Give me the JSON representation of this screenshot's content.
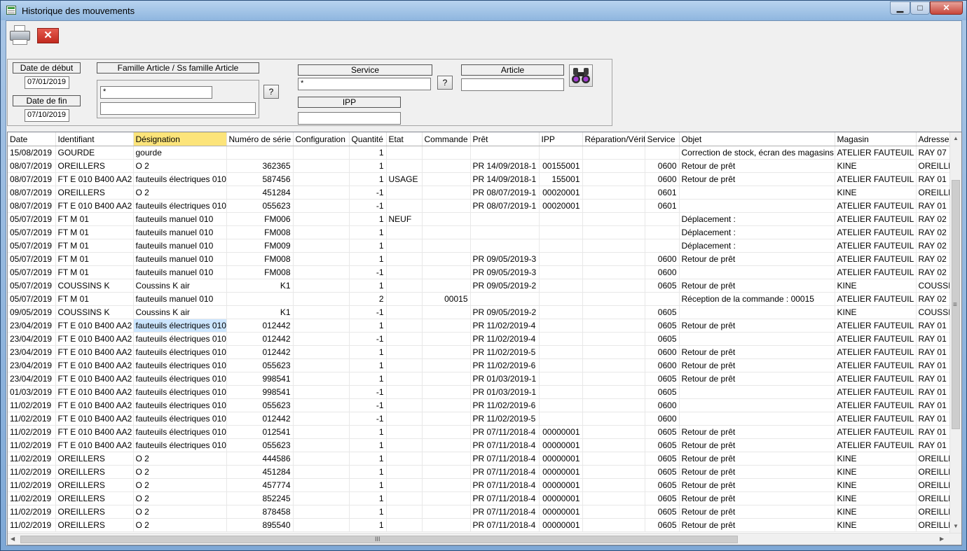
{
  "window": {
    "title": "Historique des mouvements",
    "min_glyph": "▁",
    "max_glyph": "□",
    "close_glyph": "✕"
  },
  "toolbar": {
    "print_icon": "printer-icon",
    "close_glyph": "✕"
  },
  "filters": {
    "date_debut_label": "Date de début",
    "date_debut_value": "07/01/2019",
    "date_fin_label": "Date de fin",
    "date_fin_value": "07/10/2019",
    "famille_label": "Famille Article / Ss famille Article",
    "famille_value": "*",
    "sous_famille_value": "",
    "service_label": "Service",
    "service_value": "*",
    "ipp_label": "IPP",
    "ipp_value": "",
    "article_label": "Article",
    "article_value": "",
    "help_label": "?",
    "search_icon": "binoculars-icon"
  },
  "grid": {
    "columns": [
      "Date",
      "Identifiant",
      "Désignation",
      "Numéro de série",
      "Configuration",
      "Quantité",
      "Etat",
      "Commande",
      "Prêt",
      "IPP",
      "Réparation/Vérifi",
      "Service",
      "Objet",
      "Magasin",
      "Adresse"
    ],
    "rows": [
      [
        "15/08/2019",
        "GOURDE",
        "gourde",
        "",
        "",
        "1",
        "",
        "",
        "",
        "",
        "",
        "",
        "Correction de stock, écran des magasins :",
        "ATELIER FAUTEUIL",
        "RAY 07"
      ],
      [
        "08/07/2019",
        "OREILLERS",
        "O 2",
        "362365",
        "",
        "1",
        "",
        "",
        "PR 14/09/2018-1",
        "00155001",
        "",
        "0600",
        "Retour de prêt",
        "KINE",
        "OREILLE"
      ],
      [
        "08/07/2019",
        "FT E 010 B400 AA2",
        "fauteuils électriques 010",
        "587456",
        "",
        "1",
        "USAGE",
        "",
        "PR 14/09/2018-1",
        "155001",
        "",
        "0600",
        "Retour de prêt",
        "ATELIER FAUTEUIL",
        "RAY 01"
      ],
      [
        "08/07/2019",
        "OREILLERS",
        "O 2",
        "451284",
        "",
        "-1",
        "",
        "",
        "PR 08/07/2019-1",
        "00020001",
        "",
        "0601",
        "",
        "KINE",
        "OREILLE"
      ],
      [
        "08/07/2019",
        "FT E 010 B400 AA2",
        "fauteuils électriques 010",
        "055623",
        "",
        "-1",
        "",
        "",
        "PR 08/07/2019-1",
        "00020001",
        "",
        "0601",
        "",
        "ATELIER FAUTEUIL",
        "RAY 01"
      ],
      [
        "05/07/2019",
        "FT M 01",
        "fauteuils manuel 010",
        "FM006",
        "",
        "1",
        "NEUF",
        "",
        "",
        "",
        "",
        "",
        "Déplacement :",
        "ATELIER FAUTEUIL",
        "RAY 02"
      ],
      [
        "05/07/2019",
        "FT M 01",
        "fauteuils manuel 010",
        "FM008",
        "",
        "1",
        "",
        "",
        "",
        "",
        "",
        "",
        "Déplacement :",
        "ATELIER FAUTEUIL",
        "RAY 02"
      ],
      [
        "05/07/2019",
        "FT M 01",
        "fauteuils manuel 010",
        "FM009",
        "",
        "1",
        "",
        "",
        "",
        "",
        "",
        "",
        "Déplacement :",
        "ATELIER FAUTEUIL",
        "RAY 02"
      ],
      [
        "05/07/2019",
        "FT M 01",
        "fauteuils manuel 010",
        "FM008",
        "",
        "1",
        "",
        "",
        "PR 09/05/2019-3",
        "",
        "",
        "0600",
        "Retour de prêt",
        "ATELIER FAUTEUIL",
        "RAY 02"
      ],
      [
        "05/07/2019",
        "FT M 01",
        "fauteuils manuel 010",
        "FM008",
        "",
        "-1",
        "",
        "",
        "PR 09/05/2019-3",
        "",
        "",
        "0600",
        "",
        "ATELIER FAUTEUIL",
        "RAY 02"
      ],
      [
        "05/07/2019",
        "COUSSINS K",
        "Coussins K air",
        "K1",
        "",
        "1",
        "",
        "",
        "PR 09/05/2019-2",
        "",
        "",
        "0605",
        "Retour de prêt",
        "KINE",
        "COUSSII"
      ],
      [
        "05/07/2019",
        "FT M 01",
        "fauteuils manuel 010",
        "",
        "",
        "2",
        "",
        "00015",
        "",
        "",
        "",
        "",
        "Réception de la commande : 00015",
        "ATELIER FAUTEUIL",
        "RAY 02"
      ],
      [
        "09/05/2019",
        "COUSSINS K",
        "Coussins K air",
        "K1",
        "",
        "-1",
        "",
        "",
        "PR 09/05/2019-2",
        "",
        "",
        "0605",
        "",
        "KINE",
        "COUSSII"
      ],
      [
        "23/04/2019",
        "FT E 010 B400 AA2",
        "fauteuils électriques 010",
        "012442",
        "",
        "1",
        "",
        "",
        "PR 11/02/2019-4",
        "",
        "",
        "0605",
        "Retour de prêt",
        "ATELIER FAUTEUIL",
        "RAY 01"
      ],
      [
        "23/04/2019",
        "FT E 010 B400 AA2",
        "fauteuils électriques 010",
        "012442",
        "",
        "-1",
        "",
        "",
        "PR 11/02/2019-4",
        "",
        "",
        "0605",
        "",
        "ATELIER FAUTEUIL",
        "RAY 01"
      ],
      [
        "23/04/2019",
        "FT E 010 B400 AA2",
        "fauteuils électriques 010",
        "012442",
        "",
        "1",
        "",
        "",
        "PR 11/02/2019-5",
        "",
        "",
        "0600",
        "Retour de prêt",
        "ATELIER FAUTEUIL",
        "RAY 01"
      ],
      [
        "23/04/2019",
        "FT E 010 B400 AA2",
        "fauteuils électriques 010",
        "055623",
        "",
        "1",
        "",
        "",
        "PR 11/02/2019-6",
        "",
        "",
        "0600",
        "Retour de prêt",
        "ATELIER FAUTEUIL",
        "RAY 01"
      ],
      [
        "23/04/2019",
        "FT E 010 B400 AA2",
        "fauteuils électriques 010",
        "998541",
        "",
        "1",
        "",
        "",
        "PR 01/03/2019-1",
        "",
        "",
        "0605",
        "Retour de prêt",
        "ATELIER FAUTEUIL",
        "RAY 01"
      ],
      [
        "01/03/2019",
        "FT E 010 B400 AA2",
        "fauteuils électriques 010",
        "998541",
        "",
        "-1",
        "",
        "",
        "PR 01/03/2019-1",
        "",
        "",
        "0605",
        "",
        "ATELIER FAUTEUIL",
        "RAY 01"
      ],
      [
        "11/02/2019",
        "FT E 010 B400 AA2",
        "fauteuils électriques 010",
        "055623",
        "",
        "-1",
        "",
        "",
        "PR 11/02/2019-6",
        "",
        "",
        "0600",
        "",
        "ATELIER FAUTEUIL",
        "RAY 01"
      ],
      [
        "11/02/2019",
        "FT E 010 B400 AA2",
        "fauteuils électriques 010",
        "012442",
        "",
        "-1",
        "",
        "",
        "PR 11/02/2019-5",
        "",
        "",
        "0600",
        "",
        "ATELIER FAUTEUIL",
        "RAY 01"
      ],
      [
        "11/02/2019",
        "FT E 010 B400 AA2",
        "fauteuils électriques 010",
        "012541",
        "",
        "1",
        "",
        "",
        "PR 07/11/2018-4",
        "00000001",
        "",
        "0605",
        "Retour de prêt",
        "ATELIER FAUTEUIL",
        "RAY 01"
      ],
      [
        "11/02/2019",
        "FT E 010 B400 AA2",
        "fauteuils électriques 010",
        "055623",
        "",
        "1",
        "",
        "",
        "PR 07/11/2018-4",
        "00000001",
        "",
        "0605",
        "Retour de prêt",
        "ATELIER FAUTEUIL",
        "RAY 01"
      ],
      [
        "11/02/2019",
        "OREILLERS",
        "O 2",
        "444586",
        "",
        "1",
        "",
        "",
        "PR 07/11/2018-4",
        "00000001",
        "",
        "0605",
        "Retour de prêt",
        "KINE",
        "OREILLE"
      ],
      [
        "11/02/2019",
        "OREILLERS",
        "O 2",
        "451284",
        "",
        "1",
        "",
        "",
        "PR 07/11/2018-4",
        "00000001",
        "",
        "0605",
        "Retour de prêt",
        "KINE",
        "OREILLE"
      ],
      [
        "11/02/2019",
        "OREILLERS",
        "O 2",
        "457774",
        "",
        "1",
        "",
        "",
        "PR 07/11/2018-4",
        "00000001",
        "",
        "0605",
        "Retour de prêt",
        "KINE",
        "OREILLE"
      ],
      [
        "11/02/2019",
        "OREILLERS",
        "O 2",
        "852245",
        "",
        "1",
        "",
        "",
        "PR 07/11/2018-4",
        "00000001",
        "",
        "0605",
        "Retour de prêt",
        "KINE",
        "OREILLE"
      ],
      [
        "11/02/2019",
        "OREILLERS",
        "O 2",
        "878458",
        "",
        "1",
        "",
        "",
        "PR 07/11/2018-4",
        "00000001",
        "",
        "0605",
        "Retour de prêt",
        "KINE",
        "OREILLE"
      ],
      [
        "11/02/2019",
        "OREILLERS",
        "O 2",
        "895540",
        "",
        "1",
        "",
        "",
        "PR 07/11/2018-4",
        "00000001",
        "",
        "0605",
        "Retour de prêt",
        "KINE",
        "OREILLE"
      ]
    ],
    "selected_column": 2,
    "selected_row": 13
  },
  "scroll": {
    "grip": "III",
    "up": "▲",
    "down": "▼",
    "left": "◀",
    "right": "▶",
    "vgrip": "≡"
  }
}
